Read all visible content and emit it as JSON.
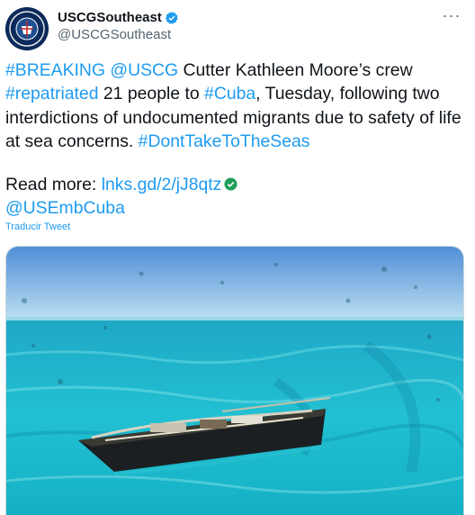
{
  "author": {
    "display_name": "USCGSoutheast",
    "handle": "@USCGSoutheast",
    "avatar_icon": "uscg-seal-icon",
    "verified_icon": "verified-badge-icon"
  },
  "more_label": "···",
  "tweet": {
    "t1": "#BREAKING",
    "t2": " ",
    "t3": "@USCG",
    "t4": " Cutter Kathleen Moore’s crew ",
    "t5": "#repatriated",
    "t6": " 21 people to ",
    "t7": "#Cuba",
    "t8": ", Tuesday, following two interdictions of undocumented migrants due to safety of life at sea concerns. ",
    "t9": "#DontTakeToTheSeas"
  },
  "read_more": {
    "label": "Read more: ",
    "link": "lnks.gd/2/jJ8qtz",
    "mention": "@USEmbCuba"
  },
  "translate_label": "Traducir Tweet",
  "colors": {
    "link": "#1d9bf0",
    "text": "#0f1419",
    "secondary": "#536471",
    "sea": "#1bb3c8"
  }
}
